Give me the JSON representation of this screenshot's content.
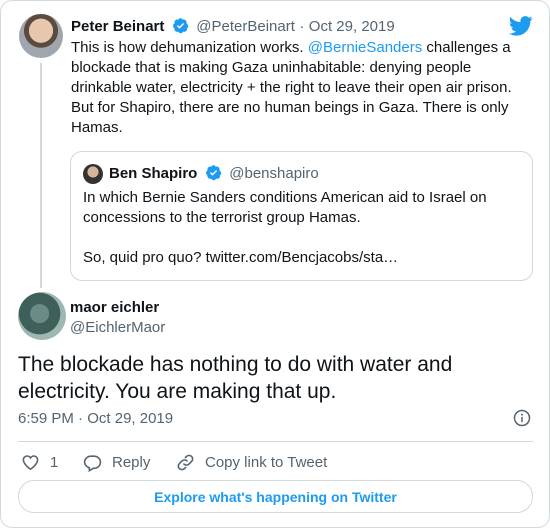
{
  "original_tweet": {
    "author_name": "Peter Beinart",
    "handle": "@PeterBeinart",
    "separator": "·",
    "date": "Oct 29, 2019",
    "text_before_mention": "This is how dehumanization works. ",
    "mention": "@BernieSanders",
    "text_after_mention": " challenges a blockade that is making Gaza uninhabitable: denying people drinkable water, electricity + the right to leave their open air prison. But for Shapiro, there are no human beings in Gaza. There is only Hamas."
  },
  "quoted_tweet": {
    "author_name": "Ben Shapiro",
    "handle": "@benshapiro",
    "line1": "In which Bernie Sanders conditions American aid to Israel on concessions to the terrorist group Hamas.",
    "line2": "So, quid pro quo? twitter.com/Bencjacobs/sta…"
  },
  "reply_tweet": {
    "author_name": "maor eichler",
    "handle": "@EichlerMaor",
    "text": "The blockade has nothing to do with water and electricity. You are making that up.",
    "time": "6:59 PM",
    "separator": "·",
    "date": "Oct 29, 2019"
  },
  "actions": {
    "like_count": "1",
    "reply_label": "Reply",
    "copy_label": "Copy link to Tweet"
  },
  "footer": {
    "explore_label": "Explore what's happening on Twitter"
  },
  "icons": {
    "verified": "verified-badge-icon",
    "brand": "twitter-bird-icon",
    "info": "info-icon",
    "like": "heart-icon",
    "reply": "reply-bubble-icon",
    "copy": "link-icon"
  },
  "colors": {
    "accent": "#1d9bf0",
    "text": "#0f1419",
    "muted": "#536471",
    "border": "#cfd9de"
  }
}
